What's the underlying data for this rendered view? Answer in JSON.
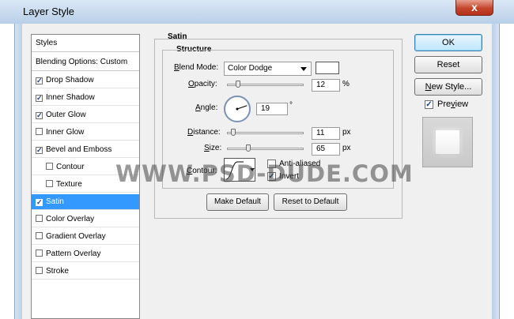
{
  "window": {
    "title": "Layer Style",
    "close_glyph": "x"
  },
  "styles_panel": {
    "header": "Styles",
    "blending": "Blending Options: Custom",
    "items": [
      {
        "label": "Drop Shadow",
        "checked": true,
        "indent": false,
        "selected": false
      },
      {
        "label": "Inner Shadow",
        "checked": true,
        "indent": false,
        "selected": false
      },
      {
        "label": "Outer Glow",
        "checked": true,
        "indent": false,
        "selected": false
      },
      {
        "label": "Inner Glow",
        "checked": false,
        "indent": false,
        "selected": false
      },
      {
        "label": "Bevel and Emboss",
        "checked": true,
        "indent": false,
        "selected": false
      },
      {
        "label": "Contour",
        "checked": false,
        "indent": true,
        "selected": false
      },
      {
        "label": "Texture",
        "checked": false,
        "indent": true,
        "selected": false
      },
      {
        "label": "Satin",
        "checked": true,
        "indent": false,
        "selected": true
      },
      {
        "label": "Color Overlay",
        "checked": false,
        "indent": false,
        "selected": false
      },
      {
        "label": "Gradient Overlay",
        "checked": false,
        "indent": false,
        "selected": false
      },
      {
        "label": "Pattern Overlay",
        "checked": false,
        "indent": false,
        "selected": false
      },
      {
        "label": "Stroke",
        "checked": false,
        "indent": false,
        "selected": false
      }
    ]
  },
  "satin": {
    "section_title": "Satin",
    "structure_title": "Structure",
    "blend_mode": {
      "label": "Blend Mode:",
      "value": "Color Dodge",
      "swatch_color": "#ffffff"
    },
    "opacity": {
      "label": "Opacity:",
      "value": "12",
      "unit": "%",
      "percent": 12
    },
    "angle": {
      "label": "Angle:",
      "value": "19",
      "unit": "°",
      "degrees": 19
    },
    "distance": {
      "label": "Distance:",
      "value": "11",
      "unit": "px",
      "percent": 5
    },
    "size": {
      "label": "Size:",
      "value": "65",
      "unit": "px",
      "percent": 26
    },
    "contour": {
      "label": "Contour:"
    },
    "anti_aliased": {
      "label": "Anti-aliased",
      "checked": false
    },
    "invert": {
      "label": "Invert",
      "checked": true
    },
    "make_default": "Make Default",
    "reset_default": "Reset to Default"
  },
  "buttons": {
    "ok": "OK",
    "reset": "Reset",
    "new_style": "New Style...",
    "preview": "Preview",
    "preview_checked": true
  },
  "watermark": "WWW.PSD-DUDE.COM",
  "colors": {
    "selected": "#3399ff",
    "titlebar": "#c9dcf0",
    "check": "#1c3d8a"
  }
}
